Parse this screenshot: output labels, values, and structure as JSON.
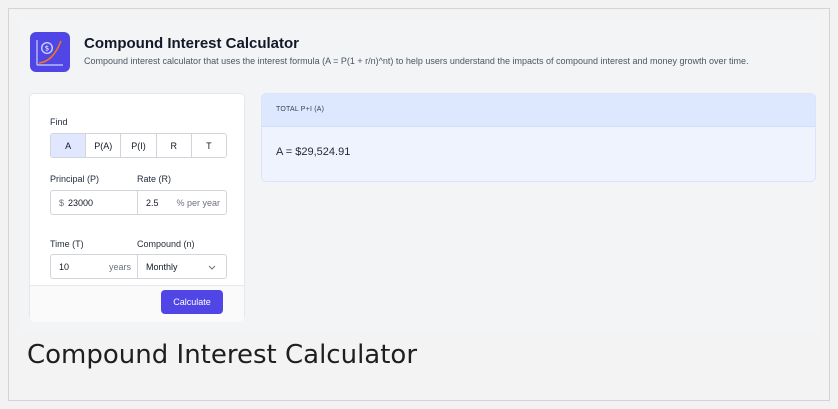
{
  "header": {
    "title": "Compound Interest Calculator",
    "subtitle": "Compound interest calculator that uses the interest formula (A = P(1 + r/n)^nt) to help users understand the impacts of compound interest and money growth over time."
  },
  "form": {
    "find_label": "Find",
    "find_options": [
      "A",
      "P(A)",
      "P(I)",
      "R",
      "T"
    ],
    "find_selected": "A",
    "principal_label": "Principal (P)",
    "principal_prefix": "$",
    "principal_value": "23000",
    "rate_label": "Rate (R)",
    "rate_value": "2.5",
    "rate_suffix": "% per year",
    "time_label": "Time (T)",
    "time_value": "10",
    "time_suffix": "years",
    "compound_label": "Compound (n)",
    "compound_value": "Monthly",
    "calculate_label": "Calculate"
  },
  "result": {
    "heading": "TOTAL P+I (A)",
    "value": "A = $29,524.91"
  },
  "caption": "Compound Interest Calculator",
  "colors": {
    "accent": "#4f46e5",
    "result_bg": "#eef3fe",
    "result_head": "#dde7fd"
  }
}
